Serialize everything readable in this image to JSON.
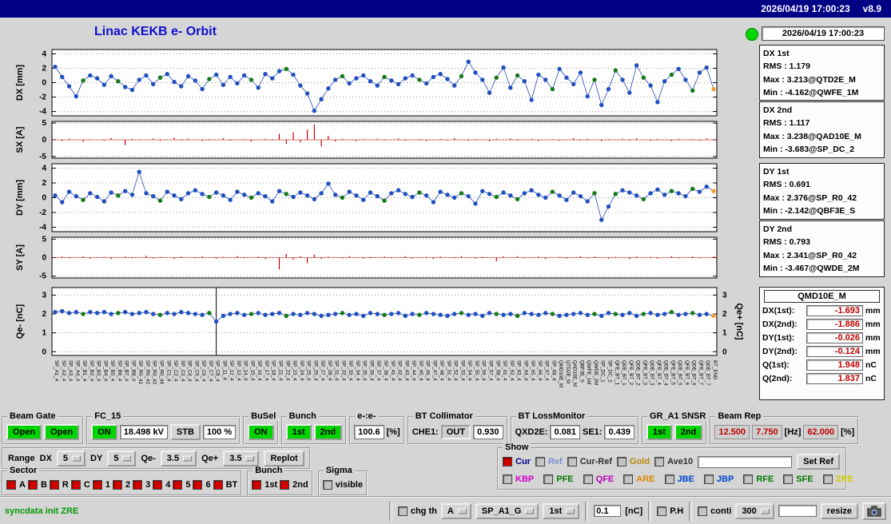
{
  "titlebar": {
    "datetime": "2026/04/19 17:00:23",
    "version": "v8.9"
  },
  "header": {
    "title": "Linac KEKB e- Orbit",
    "timestamp": "2026/04/19 17:00:23"
  },
  "stats": [
    {
      "title": "DX 1st",
      "rms": "RMS : 1.179",
      "max": "Max : 3.213@QTD2E_M",
      "min": "Min : -4.162@QWFE_1M"
    },
    {
      "title": "DX 2nd",
      "rms": "RMS : 1.117",
      "max": "Max : 3.238@QAD10E_M",
      "min": "Min : -3.683@SP_DC_2"
    },
    {
      "title": "DY 1st",
      "rms": "RMS : 0.691",
      "max": "Max : 2.376@SP_R0_42",
      "min": "Min : -2.142@QBF3E_S"
    },
    {
      "title": "DY 2nd",
      "rms": "RMS : 0.793",
      "max": "Max : 2.341@SP_R0_42",
      "min": "Min : -3.467@QWDE_2M"
    }
  ],
  "monitor": {
    "title": "QMD10E_M",
    "rows": [
      {
        "label": "DX(1st):",
        "value": "-1.693",
        "unit": "mm"
      },
      {
        "label": "DX(2nd):",
        "value": "-1.886",
        "unit": "mm"
      },
      {
        "label": "DY(1st):",
        "value": "-0.026",
        "unit": "mm"
      },
      {
        "label": "DY(2nd):",
        "value": "-0.124",
        "unit": "mm"
      },
      {
        "label": "Q(1st):",
        "value": "1.948",
        "unit": "nC"
      },
      {
        "label": "Q(2nd):",
        "value": "1.837",
        "unit": "nC"
      }
    ]
  },
  "chart_data": {
    "type": "multi-panel-orbit",
    "palette": {
      "0": "#2050c0",
      "1": "#157a15",
      "2": "#f0a030"
    },
    "point_colors": [
      0,
      0,
      0,
      0,
      1,
      0,
      0,
      0,
      0,
      1,
      0,
      0,
      0,
      0,
      0,
      1,
      0,
      0,
      0,
      0,
      0,
      0,
      1,
      0,
      0,
      0,
      0,
      0,
      1,
      0,
      0,
      0,
      0,
      1,
      0,
      0,
      0,
      0,
      0,
      0,
      0,
      1,
      0,
      0,
      0,
      0,
      0,
      1,
      0,
      0,
      0,
      0,
      1,
      0,
      0,
      0,
      0,
      0,
      1,
      0,
      0,
      0,
      0,
      1,
      0,
      0,
      1,
      0,
      0,
      0,
      0,
      1,
      0,
      0,
      0,
      0,
      0,
      1,
      0,
      0,
      1,
      0,
      0,
      0,
      1,
      0,
      0,
      0,
      1,
      0,
      0,
      1,
      0,
      0,
      2
    ],
    "plots": [
      {
        "type": "scatter",
        "name": "DX",
        "ylabel": "DX [mm]",
        "ylim": [
          -4.6,
          4.6
        ],
        "yticks": [
          4,
          2,
          0,
          -2,
          -4
        ],
        "values": [
          2.2,
          0.8,
          -0.5,
          -1.9,
          0.3,
          1.0,
          0.6,
          -0.3,
          0.9,
          0.2,
          -0.6,
          -1.0,
          0.4,
          1.0,
          -0.2,
          0.7,
          1.2,
          0.1,
          -0.5,
          0.9,
          0.3,
          -0.9,
          0.5,
          1.1,
          -0.3,
          0.8,
          -0.1,
          1.0,
          0.4,
          -0.7,
          1.2,
          0.6,
          1.6,
          1.9,
          1.1,
          -0.4,
          -1.5,
          -3.9,
          -2.3,
          -0.8,
          0.4,
          0.9,
          -0.1,
          0.6,
          1.0,
          0.2,
          -0.4,
          0.8,
          0.3,
          -0.2,
          0.6,
          1.0,
          0.4,
          -0.1,
          0.8,
          1.2,
          0.5,
          -0.4,
          0.9,
          2.9,
          1.4,
          0.4,
          -1.4,
          0.7,
          2.1,
          -0.7,
          1.0,
          0.2,
          -2.4,
          1.1,
          0.4,
          -0.9,
          1.9,
          0.7,
          -0.2,
          1.4,
          -1.9,
          0.4,
          -3.1,
          -0.9,
          1.7,
          0.4,
          -1.4,
          2.4,
          0.7,
          -0.4,
          -2.7,
          0.2,
          1.1,
          1.9,
          0.4,
          -1.1,
          1.4,
          2.1,
          -0.9
        ]
      },
      {
        "type": "stem",
        "name": "SX",
        "ylabel": "SX [A]",
        "ylim": [
          -5.5,
          5.5
        ],
        "yticks": [
          5,
          0,
          -5
        ],
        "color": "#cc0000",
        "values": [
          0,
          -0.4,
          0.3,
          0,
          -0.6,
          0.2,
          0,
          -0.3,
          0.5,
          0,
          -1.6,
          0.3,
          -0.2,
          0,
          0.4,
          -0.3,
          0,
          0.6,
          -0.2,
          0.3,
          0,
          -0.4,
          0.2,
          0,
          0.5,
          -0.3,
          0,
          0.2,
          -0.5,
          0,
          0.3,
          -0.2,
          1.8,
          -1.2,
          2.2,
          -0.8,
          3.0,
          4.6,
          -2.0,
          1.2,
          -0.5,
          0.3,
          0,
          -0.4,
          0.2,
          0,
          0.3,
          -0.2,
          0,
          0.4,
          -0.3,
          0,
          0.2,
          -0.4,
          0,
          0.3,
          -0.2,
          0.5,
          0,
          -0.3,
          0.2,
          0,
          -0.5,
          0.3,
          0,
          0.4,
          -0.2,
          0,
          0.3,
          -0.4,
          0,
          0.2,
          -0.3,
          0,
          0.5,
          -0.2,
          0.3,
          0,
          -0.4,
          0.2,
          0,
          0.3,
          -0.2,
          0.4,
          0,
          -0.3,
          0.2,
          0,
          -0.4,
          0.3,
          0,
          0.2,
          -0.3,
          0.4,
          0
        ]
      },
      {
        "type": "scatter",
        "name": "DY",
        "ylabel": "DY [mm]",
        "ylim": [
          -4.6,
          4.6
        ],
        "yticks": [
          4,
          2,
          0,
          -2,
          -4
        ],
        "values": [
          0.3,
          -0.6,
          0.8,
          0.2,
          -0.3,
          0.6,
          0.1,
          -0.5,
          0.7,
          0.3,
          0.9,
          0.4,
          3.5,
          0.6,
          0.2,
          -0.4,
          0.8,
          0.3,
          -0.2,
          0.6,
          1.0,
          0.5,
          0.1,
          0.7,
          0.3,
          -0.3,
          0.8,
          0.4,
          0.0,
          0.6,
          0.2,
          -0.5,
          0.9,
          0.5,
          0.1,
          0.7,
          0.3,
          -0.2,
          0.6,
          1.9,
          0.4,
          0.0,
          0.8,
          0.3,
          -0.3,
          0.7,
          0.2,
          -0.4,
          0.6,
          1.0,
          0.5,
          0.1,
          0.7,
          0.3,
          -0.6,
          0.8,
          0.4,
          0.0,
          0.6,
          0.2,
          -0.8,
          0.9,
          0.5,
          0.1,
          0.7,
          0.3,
          -0.2,
          0.6,
          1.0,
          0.4,
          0.0,
          0.8,
          0.3,
          -0.3,
          0.7,
          0.2,
          -0.5,
          0.6,
          -3.0,
          -1.2,
          0.5,
          1.0,
          0.7,
          0.3,
          -0.2,
          0.6,
          1.1,
          0.4,
          0.9,
          0.6,
          0.2,
          1.2,
          0.8,
          1.5,
          0.9
        ]
      },
      {
        "type": "stem",
        "name": "SY",
        "ylabel": "SY [A]",
        "ylim": [
          -5.5,
          5.5
        ],
        "yticks": [
          5,
          0,
          -5
        ],
        "color": "#cc0000",
        "values": [
          0,
          0.3,
          -0.2,
          0,
          0.4,
          -0.3,
          0,
          0.2,
          -0.4,
          0,
          0.3,
          -0.2,
          0,
          0.5,
          -0.3,
          0.2,
          0,
          -0.4,
          0.3,
          0,
          -0.2,
          0.4,
          0,
          -0.3,
          0.2,
          0,
          0.4,
          -0.2,
          0,
          0.3,
          -0.4,
          0,
          -3.2,
          1.0,
          -0.6,
          0.4,
          -1.5,
          0.8,
          -0.4,
          0.3,
          0,
          -0.2,
          0.4,
          0,
          -0.3,
          0.2,
          0,
          0.3,
          -0.2,
          0,
          0.4,
          -0.3,
          0,
          0.2,
          -0.4,
          0.3,
          0,
          -0.2,
          0.4,
          0,
          -0.3,
          0.2,
          0,
          -1.0,
          0.3,
          0,
          0.4,
          -0.2,
          0,
          0.3,
          -0.4,
          0,
          0.2,
          -0.3,
          0,
          0.4,
          -0.2,
          0.3,
          0,
          -0.3,
          0.2,
          0,
          -0.4,
          0.3,
          0,
          0.2,
          -0.3,
          0,
          0.4,
          -0.2,
          0,
          0.3,
          -0.2,
          0,
          0.3
        ]
      },
      {
        "type": "scatter",
        "name": "Q",
        "ylabel": "Qe- [nC]",
        "ylabel_right": "Qe+ [nC]",
        "ylim": [
          -0.2,
          3.4
        ],
        "yticks": [
          3,
          2,
          1,
          0
        ],
        "marker_index": 23,
        "values": [
          2.1,
          2.15,
          2.05,
          2.1,
          2.0,
          2.1,
          2.05,
          2.1,
          2.0,
          2.05,
          2.1,
          2.0,
          2.05,
          2.1,
          2.0,
          1.95,
          2.05,
          2.0,
          2.1,
          2.05,
          2.0,
          1.95,
          2.05,
          1.6,
          1.9,
          2.0,
          2.05,
          1.95,
          2.0,
          2.05,
          1.95,
          2.0,
          2.05,
          1.9,
          2.0,
          1.95,
          2.05,
          2.0,
          1.9,
          1.95,
          2.0,
          2.05,
          1.95,
          2.0,
          1.9,
          2.05,
          2.0,
          1.95,
          2.0,
          2.05,
          1.9,
          2.0,
          1.95,
          2.05,
          2.0,
          1.95,
          1.9,
          2.0,
          2.05,
          1.95,
          2.0,
          1.9,
          2.05,
          2.0,
          1.95,
          2.0,
          1.9,
          2.05,
          2.0,
          1.95,
          2.05,
          2.0,
          1.9,
          1.95,
          2.0,
          2.05,
          1.95,
          2.0,
          1.9,
          2.05,
          2.0,
          1.95,
          2.05,
          1.9,
          2.0,
          2.05,
          1.95,
          2.0,
          2.1,
          1.95,
          2.0,
          2.05,
          1.95,
          2.0,
          1.9
        ]
      }
    ],
    "xlabels": [
      "SP_A1_4",
      "SP_A2_4",
      "SP_A3_4",
      "SP_A4_4",
      "SP_B1_4",
      "SP_B2_4",
      "SP_B3_4",
      "SP_B4_4",
      "SP_B5_4",
      "SP_B6_4",
      "SP_B7_4",
      "SP_B8_4",
      "SP_R0_41",
      "SP_R0_42",
      "SP_R0_43",
      "SP_R0_44",
      "SP_C1_4",
      "SP_C2_4",
      "SP_C3_4",
      "SP_C4_4",
      "SP_C5_4",
      "SP_C6_4",
      "SP_C7_4",
      "SP_C8_4",
      "SP_11_4",
      "SP_12_4",
      "SP_13_4",
      "SP_14_4",
      "SP_15_4",
      "SP_16_4",
      "SP_17_4",
      "SP_18_4",
      "SP_21_4",
      "SP_22_4",
      "SP_23_4",
      "SP_24_4",
      "SP_25_4",
      "SP_26_4",
      "SP_27_4",
      "SP_28_4",
      "SP_31_4",
      "SP_32_4",
      "SP_33_4",
      "SP_34_4",
      "SP_35_4",
      "SP_36_4",
      "SP_37_4",
      "SP_38_4",
      "SP_41_4",
      "SP_42_4",
      "SP_43_4",
      "SP_44_4",
      "SP_45_4",
      "SP_46_4",
      "SP_47_4",
      "SP_48_4",
      "SP_51_4",
      "SP_52_4",
      "SP_53_4",
      "SP_54_4",
      "SP_55_4",
      "SP_56_4",
      "SP_57_4",
      "SP_58_4",
      "SP_61_4",
      "SP_62_4",
      "SP_63_4",
      "SP_64_4",
      "SP_65_4",
      "SP_66_4",
      "SP_67_4",
      "SP_68_4",
      "QMD10E_M",
      "QTD2E_M",
      "QAD10E_M",
      "QBF3E_S",
      "QWFE_1M",
      "QWDE_2M",
      "SP_DC_1",
      "SP_DC_2",
      "QFE_BT_1",
      "QDE_BT_1",
      "QFE_BT_2",
      "QDE_BT_2",
      "QFE_BT_3",
      "QDE_BT_3",
      "QFE_BT_4",
      "QDE_BT_4",
      "QFE_BT_5",
      "QDE_BT_5",
      "QFE_BT_6",
      "QDE_BT_6",
      "QFE_BT_7",
      "QDE_BT_7",
      "BT_END"
    ]
  },
  "panels": {
    "beam_gate": {
      "label": "Beam Gate",
      "open1": "Open",
      "open2": "Open"
    },
    "fc15": {
      "label": "FC_15",
      "on": "ON",
      "kv": "18.498 kV",
      "stb": "STB",
      "pct": "100 %"
    },
    "busel": {
      "label": "BuSel",
      "on": "ON"
    },
    "bunch": {
      "label": "Bunch",
      "b1": "1st",
      "b2": "2nd"
    },
    "ee": {
      "label": "e-:e-",
      "value": "100.6",
      "unit": "[%]"
    },
    "bt_col": {
      "label": "BT Collimator",
      "che1": "CHE1:",
      "state": "OUT",
      "value": "0.930"
    },
    "bt_loss": {
      "label": "BT LossMonitor",
      "qxd2e": "QXD2E:",
      "qxd2e_v": "0.081",
      "se1": "SE1:",
      "se1_v": "0.439"
    },
    "gr": {
      "label": "GR_A1 SNSR",
      "b1": "1st",
      "b2": "2nd"
    },
    "beam_rep": {
      "label": "Beam Rep",
      "v1": "12.500",
      "v2": "7.750",
      "hz": "[Hz]",
      "v3": "62.000",
      "pct": "[%]"
    }
  },
  "range_row": {
    "title": "Range",
    "dx": "DX",
    "dx_v": "5",
    "dy": "DY",
    "dy_v": "5",
    "qm": "Qe-",
    "qm_v": "3.5",
    "qp": "Qe+",
    "qp_v": "3.5",
    "replot": "Replot"
  },
  "sector": {
    "label": "Sector",
    "items": [
      {
        "label": "A",
        "checked": true
      },
      {
        "label": "B",
        "checked": true
      },
      {
        "label": "R",
        "checked": true
      },
      {
        "label": "C",
        "checked": true
      },
      {
        "label": "1",
        "checked": true
      },
      {
        "label": "2",
        "checked": true
      },
      {
        "label": "3",
        "checked": true
      },
      {
        "label": "4",
        "checked": true
      },
      {
        "label": "5",
        "checked": true
      },
      {
        "label": "6",
        "checked": true
      },
      {
        "label": "BT",
        "checked": true
      }
    ]
  },
  "bunch_sel": {
    "label": "Bunch",
    "items": [
      {
        "label": "1st",
        "checked": true
      },
      {
        "label": "2nd",
        "checked": true
      }
    ]
  },
  "sigma": {
    "label": "Sigma",
    "items": [
      {
        "label": "visible",
        "checked": false
      }
    ]
  },
  "show": {
    "label": "Show",
    "row1": [
      {
        "label": "Cur",
        "color": "#000090",
        "checked": true
      },
      {
        "label": "Ref",
        "color": "#8090d0",
        "checked": false
      },
      {
        "label": "Cur-Ref",
        "color": "#303030",
        "checked": false
      },
      {
        "label": "Gold",
        "color": "#b8860b",
        "checked": false
      },
      {
        "label": "Ave10",
        "color": "#303030",
        "checked": false
      }
    ],
    "entry": "",
    "set_ref": "Set Ref",
    "row2": [
      {
        "label": "KBP",
        "color": "#cc00cc",
        "checked": false
      },
      {
        "label": "PFE",
        "color": "#007700",
        "checked": false
      },
      {
        "label": "QFE",
        "color": "#bb00bb",
        "checked": false
      },
      {
        "label": "ARE",
        "color": "#dd8800",
        "checked": false
      },
      {
        "label": "JBE",
        "color": "#0044cc",
        "checked": false
      },
      {
        "label": "JBP",
        "color": "#0044cc",
        "checked": false
      },
      {
        "label": "RFE",
        "color": "#007700",
        "checked": false
      },
      {
        "label": "SFE",
        "color": "#007700",
        "checked": false
      },
      {
        "label": "ZRE",
        "color": "#cccc00",
        "checked": false
      }
    ]
  },
  "statusbar": {
    "message": "syncdata init ZRE",
    "chg_th": "chg th",
    "chg_th_checked": false,
    "sel_a": "A",
    "sel_sp": "SP_A1_G",
    "sel_bunch": "1st",
    "threshold": "0.1",
    "unit": "[nC]",
    "ph": "P.H",
    "ph_checked": false,
    "conti": "conti",
    "conti_checked": false,
    "num": "300",
    "entry": "",
    "resize": "resize"
  }
}
